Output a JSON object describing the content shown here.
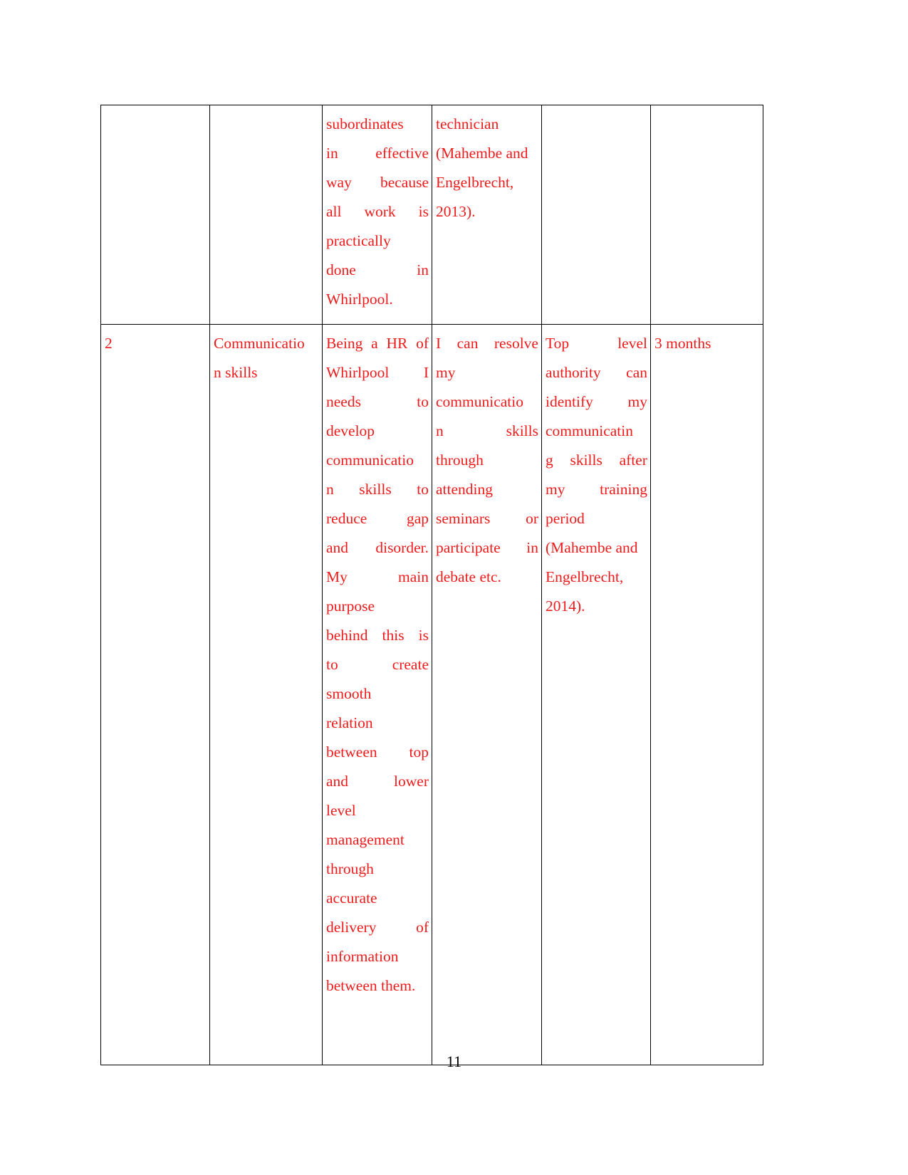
{
  "document": {
    "page_number": "11",
    "text_color": "#ED1C1C",
    "page_number_color": "#000000",
    "border_color": "#000000"
  },
  "table": {
    "rows": [
      {
        "row_index": 1,
        "cells": {
          "col1": "",
          "col2": "",
          "col3_lines": [
            [
              "subordinates"
            ],
            [
              "in",
              "effective"
            ],
            [
              "way",
              "because"
            ],
            [
              "all",
              "work",
              "is"
            ],
            [
              "practically"
            ],
            [
              "done",
              "in"
            ],
            [
              "Whirlpool."
            ]
          ],
          "col3_text": "subordinates in effective way because all work is practically done in Whirlpool.",
          "col4_lines": [
            [
              "technician"
            ],
            [
              "(Mahembe and"
            ],
            [
              "Engelbrecht,"
            ],
            [
              "2013)."
            ]
          ],
          "col4_text": "technician (Mahembe and Engelbrecht, 2013).",
          "col5": "",
          "col6": ""
        }
      },
      {
        "row_index": 2,
        "cells": {
          "col1": "2",
          "col2_lines": [
            [
              "Communicatio"
            ],
            [
              "n skills"
            ]
          ],
          "col2_text": "Communication skills",
          "col3_lines": [
            [
              "Being",
              "a",
              "HR",
              "of"
            ],
            [
              "Whirlpool",
              "I"
            ],
            [
              "needs",
              "to"
            ],
            [
              "develop"
            ],
            [
              "communicatio"
            ],
            [
              "n",
              "skills",
              "to"
            ],
            [
              "reduce",
              "gap"
            ],
            [
              "and",
              "disorder."
            ],
            [
              "My",
              "main"
            ],
            [
              "purpose"
            ],
            [
              "behind",
              "this",
              "is"
            ],
            [
              "to",
              "create"
            ],
            [
              "smooth"
            ],
            [
              "relation"
            ],
            [
              "between",
              "top"
            ],
            [
              "and",
              "lower"
            ],
            [
              "level"
            ],
            [
              "management"
            ],
            [
              "through"
            ],
            [
              "accurate"
            ],
            [
              "delivery",
              "of"
            ],
            [
              "information"
            ],
            [
              "between them."
            ]
          ],
          "col3_text": "Being a HR of Whirlpool I needs to develop communication skills to reduce gap and disorder. My main purpose behind this is to create smooth relation between top and lower level management through accurate delivery of information between them.",
          "col4_lines": [
            [
              "I",
              "can",
              "resolve"
            ],
            [
              "my"
            ],
            [
              "communicatio"
            ],
            [
              "n",
              "skills"
            ],
            [
              "through"
            ],
            [
              "attending"
            ],
            [
              "seminars",
              "or"
            ],
            [
              "participate",
              "in"
            ],
            [
              "debate etc."
            ]
          ],
          "col4_text": "I can resolve my communication skills through attending seminars or participate in debate etc.",
          "col5_lines": [
            [
              "Top",
              "level"
            ],
            [
              "authority",
              "can"
            ],
            [
              "identify",
              "my"
            ],
            [
              "communicatin"
            ],
            [
              "g",
              "skills",
              "after"
            ],
            [
              "my",
              "training"
            ],
            [
              "period"
            ],
            [
              "(Mahembe and"
            ],
            [
              "Engelbrecht,"
            ],
            [
              "2014)."
            ]
          ],
          "col5_text": "Top level authority can identify my communicating skills after my training period (Mahembe and Engelbrecht, 2014).",
          "col6": "3 months"
        }
      }
    ]
  }
}
